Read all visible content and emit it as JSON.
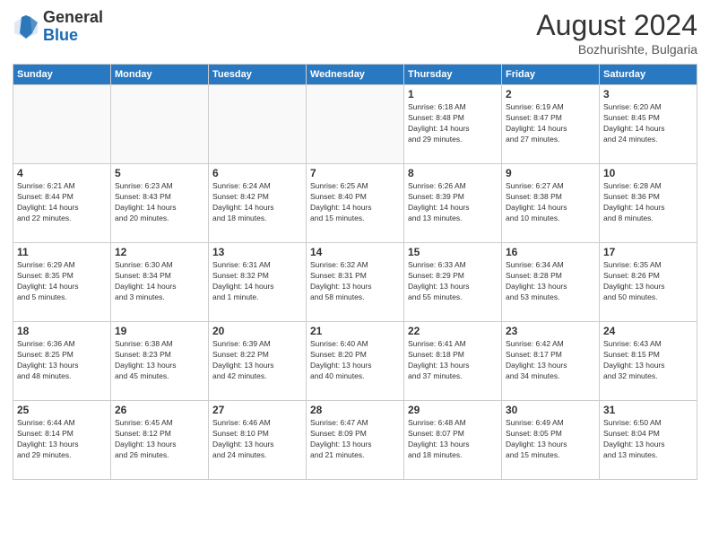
{
  "header": {
    "logo_general": "General",
    "logo_blue": "Blue",
    "month_title": "August 2024",
    "location": "Bozhurishte, Bulgaria"
  },
  "weekdays": [
    "Sunday",
    "Monday",
    "Tuesday",
    "Wednesday",
    "Thursday",
    "Friday",
    "Saturday"
  ],
  "weeks": [
    [
      {
        "day": "",
        "info": ""
      },
      {
        "day": "",
        "info": ""
      },
      {
        "day": "",
        "info": ""
      },
      {
        "day": "",
        "info": ""
      },
      {
        "day": "1",
        "info": "Sunrise: 6:18 AM\nSunset: 8:48 PM\nDaylight: 14 hours\nand 29 minutes."
      },
      {
        "day": "2",
        "info": "Sunrise: 6:19 AM\nSunset: 8:47 PM\nDaylight: 14 hours\nand 27 minutes."
      },
      {
        "day": "3",
        "info": "Sunrise: 6:20 AM\nSunset: 8:45 PM\nDaylight: 14 hours\nand 24 minutes."
      }
    ],
    [
      {
        "day": "4",
        "info": "Sunrise: 6:21 AM\nSunset: 8:44 PM\nDaylight: 14 hours\nand 22 minutes."
      },
      {
        "day": "5",
        "info": "Sunrise: 6:23 AM\nSunset: 8:43 PM\nDaylight: 14 hours\nand 20 minutes."
      },
      {
        "day": "6",
        "info": "Sunrise: 6:24 AM\nSunset: 8:42 PM\nDaylight: 14 hours\nand 18 minutes."
      },
      {
        "day": "7",
        "info": "Sunrise: 6:25 AM\nSunset: 8:40 PM\nDaylight: 14 hours\nand 15 minutes."
      },
      {
        "day": "8",
        "info": "Sunrise: 6:26 AM\nSunset: 8:39 PM\nDaylight: 14 hours\nand 13 minutes."
      },
      {
        "day": "9",
        "info": "Sunrise: 6:27 AM\nSunset: 8:38 PM\nDaylight: 14 hours\nand 10 minutes."
      },
      {
        "day": "10",
        "info": "Sunrise: 6:28 AM\nSunset: 8:36 PM\nDaylight: 14 hours\nand 8 minutes."
      }
    ],
    [
      {
        "day": "11",
        "info": "Sunrise: 6:29 AM\nSunset: 8:35 PM\nDaylight: 14 hours\nand 5 minutes."
      },
      {
        "day": "12",
        "info": "Sunrise: 6:30 AM\nSunset: 8:34 PM\nDaylight: 14 hours\nand 3 minutes."
      },
      {
        "day": "13",
        "info": "Sunrise: 6:31 AM\nSunset: 8:32 PM\nDaylight: 14 hours\nand 1 minute."
      },
      {
        "day": "14",
        "info": "Sunrise: 6:32 AM\nSunset: 8:31 PM\nDaylight: 13 hours\nand 58 minutes."
      },
      {
        "day": "15",
        "info": "Sunrise: 6:33 AM\nSunset: 8:29 PM\nDaylight: 13 hours\nand 55 minutes."
      },
      {
        "day": "16",
        "info": "Sunrise: 6:34 AM\nSunset: 8:28 PM\nDaylight: 13 hours\nand 53 minutes."
      },
      {
        "day": "17",
        "info": "Sunrise: 6:35 AM\nSunset: 8:26 PM\nDaylight: 13 hours\nand 50 minutes."
      }
    ],
    [
      {
        "day": "18",
        "info": "Sunrise: 6:36 AM\nSunset: 8:25 PM\nDaylight: 13 hours\nand 48 minutes."
      },
      {
        "day": "19",
        "info": "Sunrise: 6:38 AM\nSunset: 8:23 PM\nDaylight: 13 hours\nand 45 minutes."
      },
      {
        "day": "20",
        "info": "Sunrise: 6:39 AM\nSunset: 8:22 PM\nDaylight: 13 hours\nand 42 minutes."
      },
      {
        "day": "21",
        "info": "Sunrise: 6:40 AM\nSunset: 8:20 PM\nDaylight: 13 hours\nand 40 minutes."
      },
      {
        "day": "22",
        "info": "Sunrise: 6:41 AM\nSunset: 8:18 PM\nDaylight: 13 hours\nand 37 minutes."
      },
      {
        "day": "23",
        "info": "Sunrise: 6:42 AM\nSunset: 8:17 PM\nDaylight: 13 hours\nand 34 minutes."
      },
      {
        "day": "24",
        "info": "Sunrise: 6:43 AM\nSunset: 8:15 PM\nDaylight: 13 hours\nand 32 minutes."
      }
    ],
    [
      {
        "day": "25",
        "info": "Sunrise: 6:44 AM\nSunset: 8:14 PM\nDaylight: 13 hours\nand 29 minutes."
      },
      {
        "day": "26",
        "info": "Sunrise: 6:45 AM\nSunset: 8:12 PM\nDaylight: 13 hours\nand 26 minutes."
      },
      {
        "day": "27",
        "info": "Sunrise: 6:46 AM\nSunset: 8:10 PM\nDaylight: 13 hours\nand 24 minutes."
      },
      {
        "day": "28",
        "info": "Sunrise: 6:47 AM\nSunset: 8:09 PM\nDaylight: 13 hours\nand 21 minutes."
      },
      {
        "day": "29",
        "info": "Sunrise: 6:48 AM\nSunset: 8:07 PM\nDaylight: 13 hours\nand 18 minutes."
      },
      {
        "day": "30",
        "info": "Sunrise: 6:49 AM\nSunset: 8:05 PM\nDaylight: 13 hours\nand 15 minutes."
      },
      {
        "day": "31",
        "info": "Sunrise: 6:50 AM\nSunset: 8:04 PM\nDaylight: 13 hours\nand 13 minutes."
      }
    ]
  ]
}
